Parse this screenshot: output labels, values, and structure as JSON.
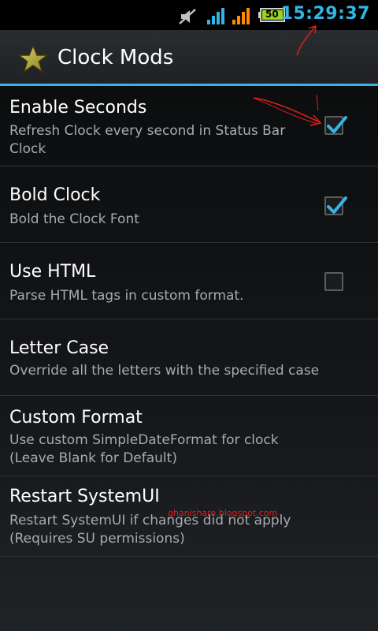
{
  "status_bar": {
    "time": "15:29:37",
    "battery_level": "50",
    "icons": [
      "mute-icon",
      "signal-icon-1",
      "signal-icon-2",
      "battery-icon"
    ],
    "time_color": "#33b5e5",
    "signal1_color": "#33b5e5",
    "signal2_color": "#ff8a00"
  },
  "action_bar": {
    "title": "Clock Mods",
    "icon": "star-icon",
    "accent": "#33b5e5"
  },
  "preferences": [
    {
      "title": "Enable Seconds",
      "summary": "Refresh Clock every second in Status Bar Clock",
      "checkbox": true,
      "checked": true
    },
    {
      "title": "Bold Clock",
      "summary": "Bold the Clock Font",
      "checkbox": true,
      "checked": true
    },
    {
      "title": "Use HTML",
      "summary": "Parse HTML tags in custom format.",
      "checkbox": true,
      "checked": false
    },
    {
      "title": "Letter Case",
      "summary": "Override all the letters with the specified case",
      "checkbox": false
    },
    {
      "title": "Custom Format",
      "summary": "Use custom SimpleDateFormat for clock (Leave Blank for Default)",
      "checkbox": false
    },
    {
      "title": "Restart SystemUI",
      "summary": "Restart SystemUI if changes did not apply (Requires SU permissions)",
      "checkbox": false
    }
  ],
  "watermark": "ghanishare.blogspot.com"
}
